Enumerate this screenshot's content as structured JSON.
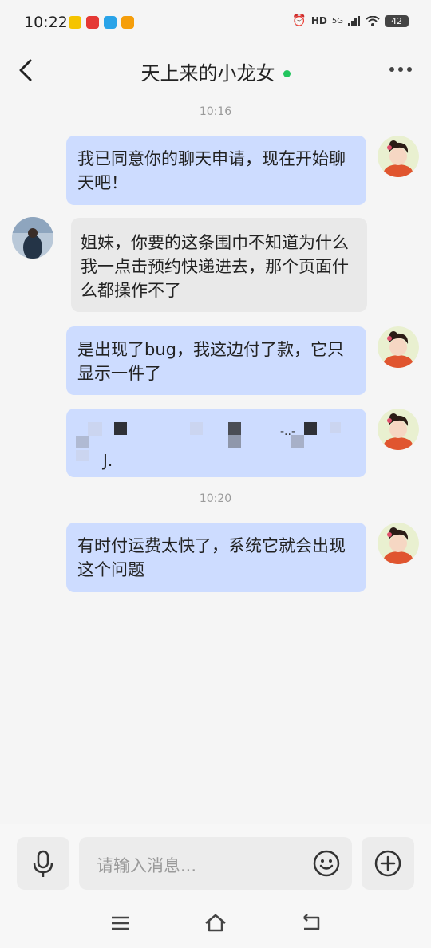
{
  "status": {
    "time": "10:22",
    "network": "5G",
    "battery": "42",
    "hd": "HD"
  },
  "header": {
    "title": "天上来的小龙女"
  },
  "messages": {
    "ts1": "10:16",
    "m1": "我已同意你的聊天申请，现在开始聊天吧！",
    "m2": "姐妹，你要的这条围巾不知道为什么我一点击预约快递进去，那个页面什么都操作不了",
    "m3": "是出现了bug，我这边付了款，它只显示一件了",
    "m4_partial": "-..-",
    "m4_tail": "J.",
    "ts2": "10:20",
    "m5": "有时付运费太快了，系统它就会出现这个问题"
  },
  "input": {
    "placeholder": "请输入消息..."
  },
  "colors": {
    "accent": "#22c55e",
    "bubble_out": "#cddcff",
    "bubble_in": "#e9e9e9"
  },
  "icons": [
    "microphone-icon",
    "emoji-icon",
    "plus-circle-icon",
    "back-arrow-icon",
    "more-dots-icon",
    "menu-icon",
    "home-icon",
    "return-icon"
  ]
}
